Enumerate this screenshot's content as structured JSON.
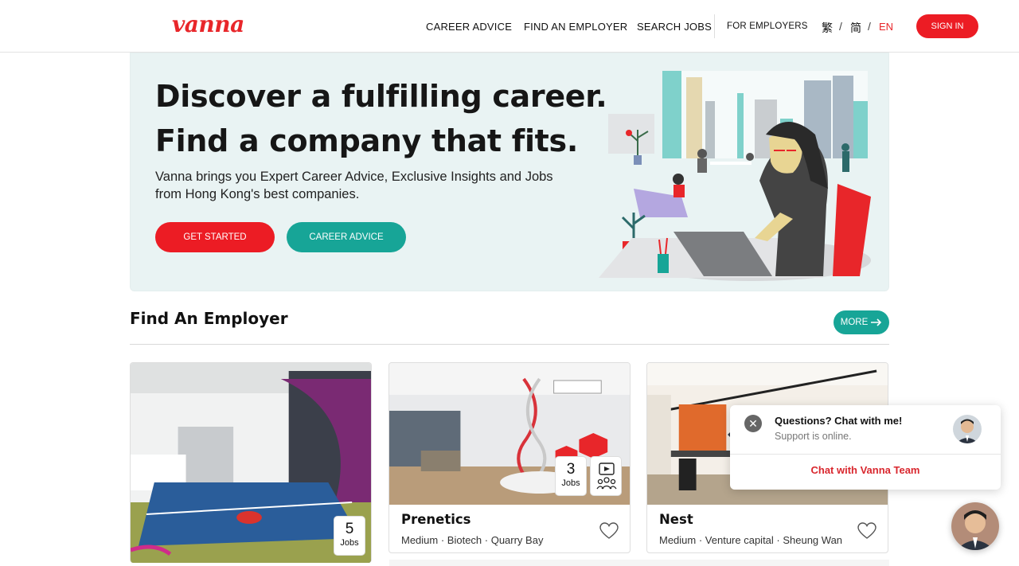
{
  "header": {
    "logo": "vanna",
    "nav": [
      "CAREER ADVICE",
      "FIND AN EMPLOYER",
      "SEARCH JOBS",
      "FOR EMPLOYERS"
    ],
    "languages": [
      "繁",
      "简",
      "EN"
    ],
    "language_separator": "/",
    "active_language": "EN",
    "sign_in": "SIGN IN"
  },
  "hero": {
    "title_line1": "Discover a fulfilling career.",
    "title_line2": "Find a company that fits.",
    "subtitle": "Vanna brings you Expert Career Advice, Exclusive Insights and Jobs from Hong Kong's best companies.",
    "primary_button": "GET STARTED",
    "secondary_button": "CAREER ADVICE"
  },
  "employers": {
    "title": "Find An Employer",
    "more": "MORE",
    "cards": [
      {
        "name": "",
        "meta": "",
        "jobs": "5",
        "jobs_label": "Jobs"
      },
      {
        "name": "Prenetics",
        "meta": "Medium · Biotech · Quarry Bay",
        "jobs": "3",
        "jobs_label": "Jobs"
      },
      {
        "name": "Nest",
        "meta": "Medium · Venture capital · Sheung Wan"
      }
    ]
  },
  "chat": {
    "title": "Questions? Chat with me!",
    "status": "Support is online.",
    "cta": "Chat with Vanna Team",
    "close_symbol": "✕"
  },
  "colors": {
    "brand_red": "#ec1c24",
    "teal": "#17a597",
    "hero_bg": "#e9f3f3"
  }
}
